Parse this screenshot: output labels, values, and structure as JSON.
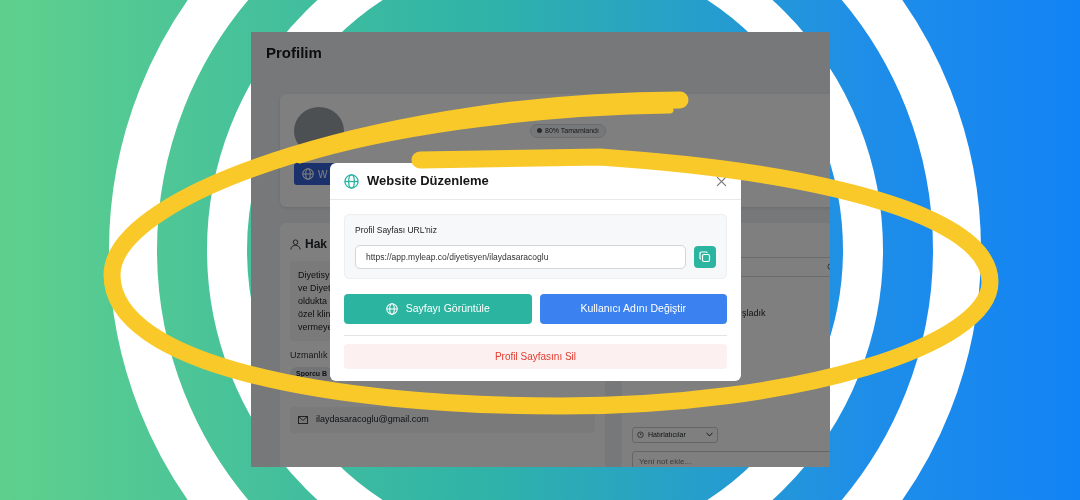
{
  "page": {
    "title": "Profilim"
  },
  "profile": {
    "completion": "80% Tamamlandı",
    "website_button": "W"
  },
  "about": {
    "title": "Hak",
    "lines": [
      "Diyetisy",
      "ve Diyet",
      "oldukta",
      "özel klin",
      "vermeye"
    ],
    "expertise_label": "Uzmanlık",
    "tags": [
      "Sporcu B"
    ],
    "email": "ilaydasaracoglu@gmail.com"
  },
  "notes": {
    "items": [
      "şladık"
    ],
    "filter": "Hatırlatıcılar",
    "new_note_placeholder": "Yeni not ekle..."
  },
  "modal": {
    "title": "Website Düzenleme",
    "url_label": "Profil Sayfası URL'niz",
    "url": "https://app.myleap.co/diyetisyen/ilaydasaracoglu",
    "view_button": "Sayfayı Görüntüle",
    "rename_button": "Kullanıcı Adını Değiştir",
    "delete_button": "Profil Sayfasını Sil"
  }
}
